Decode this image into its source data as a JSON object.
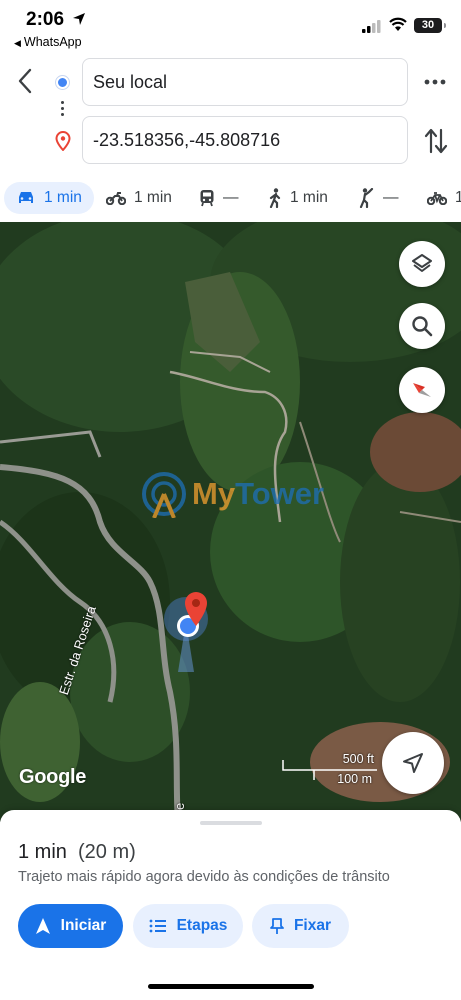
{
  "status_bar": {
    "time": "2:06",
    "back_app": "WhatsApp",
    "battery": "30"
  },
  "directions": {
    "origin_value": "Seu local",
    "destination_value": "-23.518356,-45.808716"
  },
  "modes": [
    {
      "icon": "car-icon",
      "value": "1 min",
      "active": true
    },
    {
      "icon": "motorcycle-icon",
      "value": "1 min",
      "active": false
    },
    {
      "icon": "transit-icon",
      "value": "—",
      "active": false
    },
    {
      "icon": "walk-icon",
      "value": "1 min",
      "active": false
    },
    {
      "icon": "ride-icon",
      "value": "—",
      "active": false
    },
    {
      "icon": "bike-icon",
      "value": "1",
      "active": false
    }
  ],
  "map": {
    "road_label": "Estr. da Roseira",
    "road_label_partial": "e",
    "google_logo": "Google",
    "scale_imperial": "500 ft",
    "scale_metric": "100 m",
    "watermark": {
      "part1": "My",
      "part2": "Tower"
    }
  },
  "route_sheet": {
    "eta": "1 min",
    "distance": "(20 m)",
    "reason": "Trajeto mais rápido agora devido às condições de trânsito",
    "start_label": "Iniciar",
    "steps_label": "Etapas",
    "pin_label": "Fixar"
  },
  "colors": {
    "accent": "#1a73e8",
    "accent_light": "#e8f0fe",
    "origin_blue": "#4285f4",
    "pin_red": "#ea4335"
  }
}
